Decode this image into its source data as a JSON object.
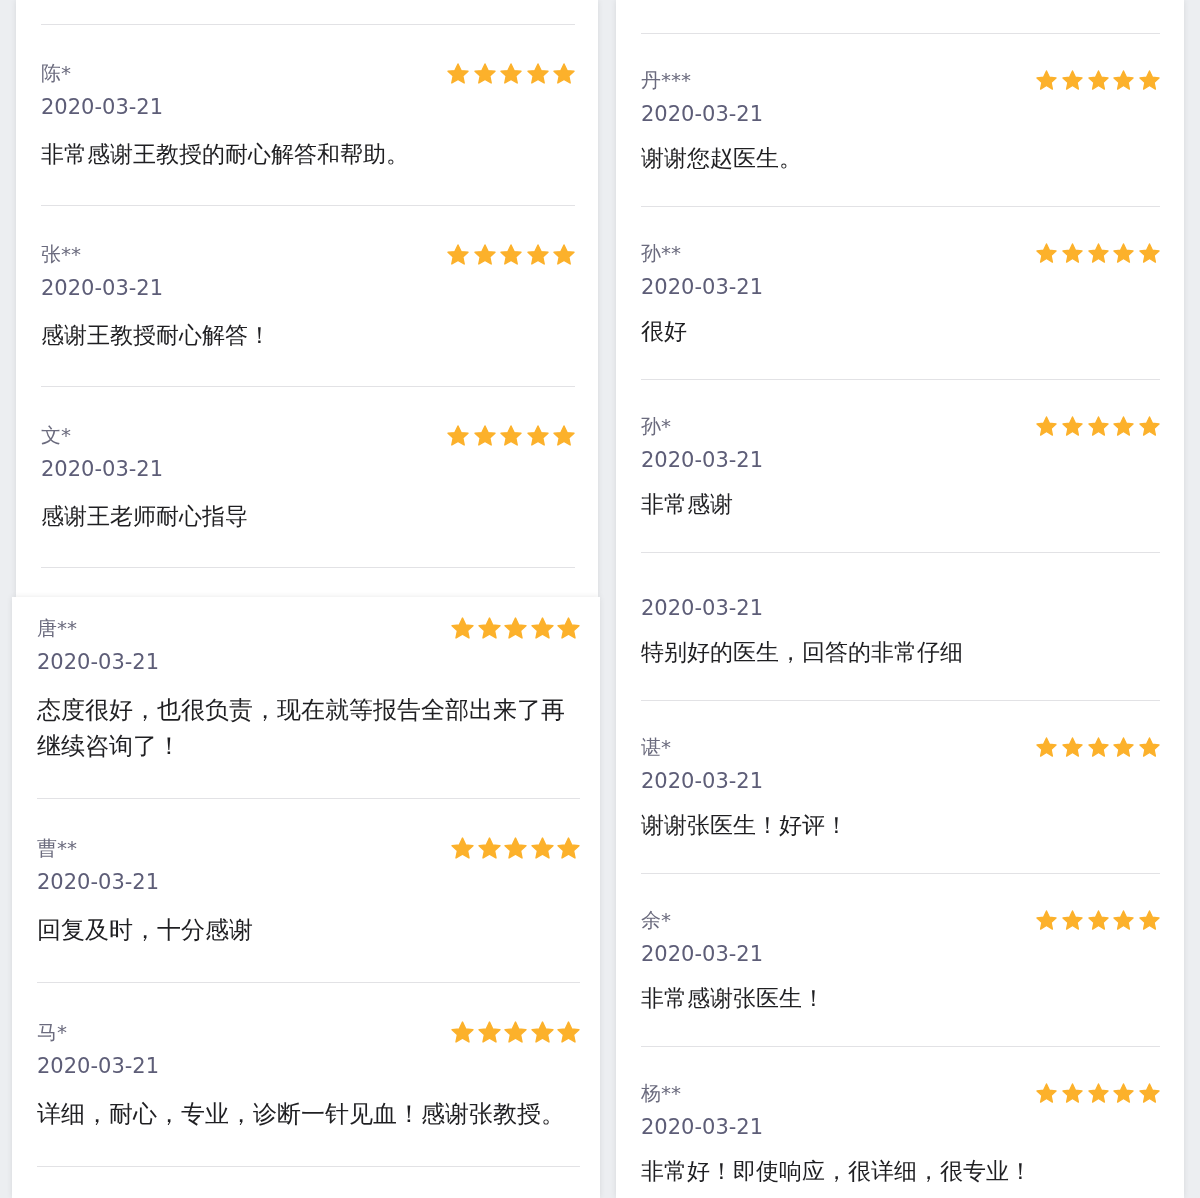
{
  "panels": [
    {
      "reviews": [
        {
          "name": "陈*",
          "date": "2020-03-21",
          "text": "非常感谢王教授的耐心解答和帮助。",
          "stars": 5
        },
        {
          "name": "张**",
          "date": "2020-03-21",
          "text": "感谢王教授耐心解答！",
          "stars": 5
        },
        {
          "name": "文*",
          "date": "2020-03-21",
          "text": "感谢王老师耐心指导",
          "stars": 5
        }
      ]
    },
    {
      "reviews": [
        {
          "name": "唐**",
          "date": "2020-03-21",
          "text": "态度很好，也很负责，现在就等报告全部出来了再继续咨询了！",
          "stars": 5
        },
        {
          "name": "曹**",
          "date": "2020-03-21",
          "text": "回复及时，十分感谢",
          "stars": 5
        },
        {
          "name": "马*",
          "date": "2020-03-21",
          "text": "详细，耐心，专业，诊断一针见血！感谢张教授。",
          "stars": 5
        }
      ]
    },
    {
      "reviews": [
        {
          "name": "丹***",
          "date": "2020-03-21",
          "text": "谢谢您赵医生。",
          "stars": 5
        },
        {
          "name": "孙**",
          "date": "2020-03-21",
          "text": "很好",
          "stars": 5
        },
        {
          "name": "孙*",
          "date": "2020-03-21",
          "text": "非常感谢",
          "stars": 5
        },
        {
          "date": "2020-03-21",
          "text": "特别好的医生，回答的非常仔细"
        },
        {
          "name": "谌*",
          "date": "2020-03-21",
          "text": "谢谢张医生！好评！",
          "stars": 5
        },
        {
          "name": "余*",
          "date": "2020-03-21",
          "text": "非常感谢张医生！",
          "stars": 5
        },
        {
          "name": "杨**",
          "date": "2020-03-21",
          "text": "非常好！即使响应，很详细，很专业！",
          "stars": 5
        }
      ]
    }
  ]
}
